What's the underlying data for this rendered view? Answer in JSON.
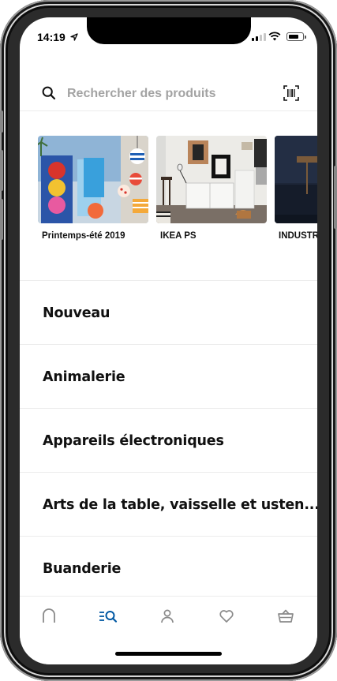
{
  "status_bar": {
    "time": "14:19",
    "cellular_bars_active": 2,
    "cellular_bars_total": 4,
    "battery_level": 0.8
  },
  "search": {
    "placeholder": "Rechercher des produits",
    "icon": "search-icon",
    "scan_icon": "barcode-scanner-icon"
  },
  "collections": [
    {
      "label": "Printemps-été 2019"
    },
    {
      "label": "IKEA PS"
    },
    {
      "label": "INDUSTRIELL"
    }
  ],
  "categories": [
    {
      "label": "Nouveau"
    },
    {
      "label": "Animalerie"
    },
    {
      "label": "Appareils électroniques"
    },
    {
      "label": "Arts de la table, vaisselle et usten..."
    },
    {
      "label": "Buanderie"
    }
  ],
  "bottom_nav": {
    "items": [
      {
        "icon": "home-icon",
        "active": false
      },
      {
        "icon": "browse-search-icon",
        "active": true
      },
      {
        "icon": "profile-icon",
        "active": false
      },
      {
        "icon": "heart-icon",
        "active": false
      },
      {
        "icon": "basket-icon",
        "active": false
      }
    ],
    "active_color": "#0058a3",
    "inactive_color": "#8a8a8a"
  }
}
